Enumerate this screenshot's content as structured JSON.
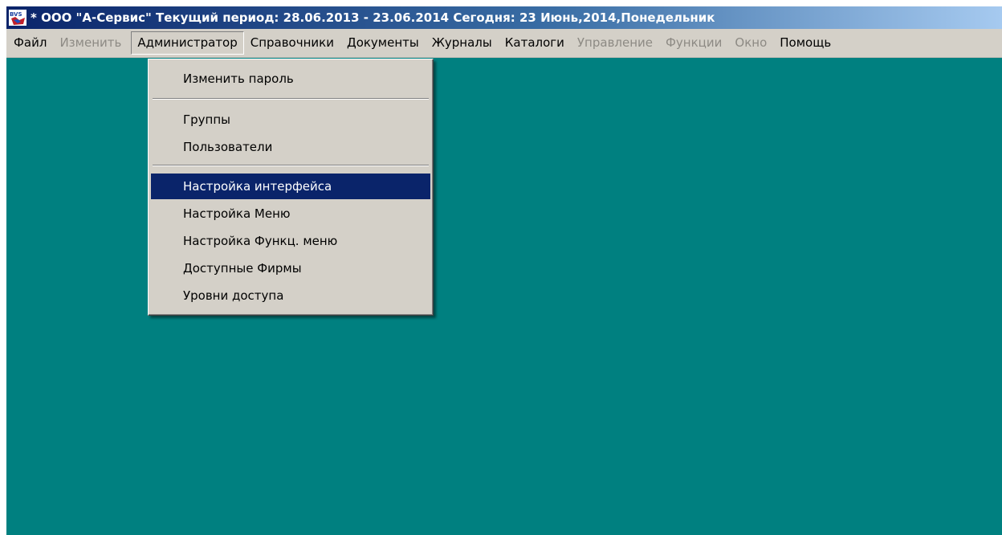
{
  "window": {
    "title": "* ООО \"А-Сервис\"  Текущий период: 28.06.2013 - 23.06.2014  Сегодня: 23 Июнь,2014,Понедельник",
    "icon": "bvs-app-icon",
    "desktop_color": "#008080",
    "title_color": "#0a246a"
  },
  "menubar": {
    "items": [
      {
        "label": "Файл",
        "enabled": true
      },
      {
        "label": "Изменить",
        "enabled": false
      },
      {
        "label": "Администратор",
        "enabled": true,
        "open": true
      },
      {
        "label": "Справочники",
        "enabled": true
      },
      {
        "label": "Документы",
        "enabled": true
      },
      {
        "label": "Журналы",
        "enabled": true
      },
      {
        "label": "Каталоги",
        "enabled": true
      },
      {
        "label": "Управление",
        "enabled": false
      },
      {
        "label": "Функции",
        "enabled": false
      },
      {
        "label": "Окно",
        "enabled": false
      },
      {
        "label": "Помощь",
        "enabled": true
      }
    ]
  },
  "dropdown": {
    "items": [
      {
        "label": "Изменить пароль"
      },
      {
        "label": "Группы"
      },
      {
        "label": "Пользователи"
      },
      {
        "label": "Настройка интерфейса",
        "highlighted": true
      },
      {
        "label": "Настройка Меню"
      },
      {
        "label": "Настройка Функц. меню"
      },
      {
        "label": "Доступные Фирмы"
      },
      {
        "label": "Уровни доступа"
      }
    ],
    "highlight_color": "#0a246a"
  }
}
